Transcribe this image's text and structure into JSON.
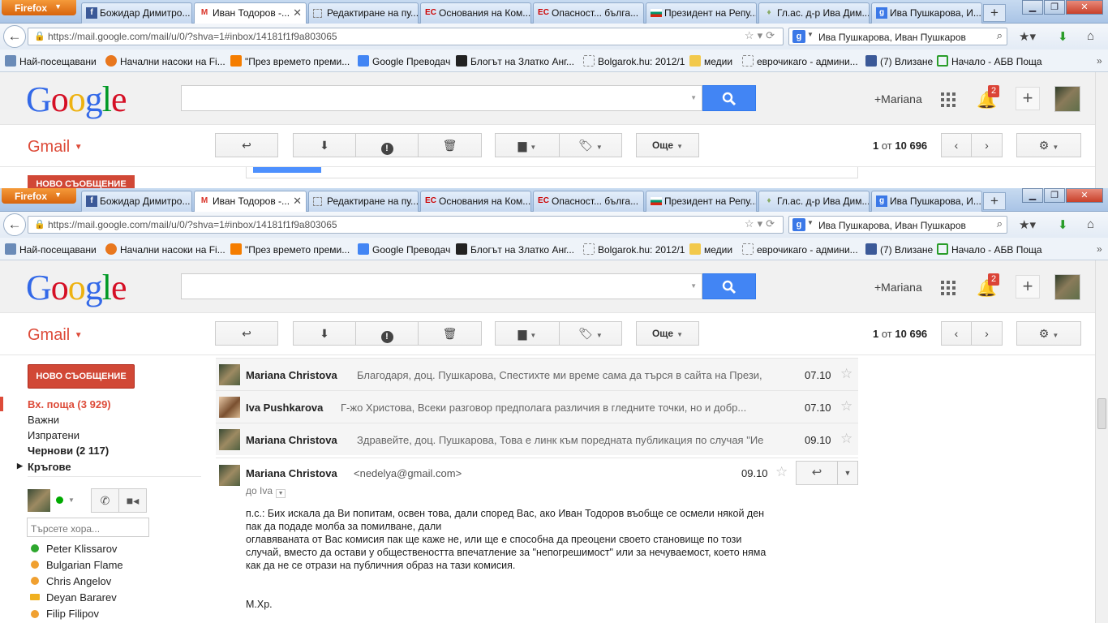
{
  "browser": {
    "button": "Firefox",
    "tabs": [
      {
        "title": "Божидар Димитро...",
        "icon": "facebook-icon"
      },
      {
        "title": "Иван Тодоров -...",
        "icon": "gmail-icon"
      },
      {
        "title": "Редактиране на пу...",
        "icon": "page-icon"
      },
      {
        "title": "Основания на Ком...",
        "icon": "ec-icon"
      },
      {
        "title": "Опасност... бълга...",
        "icon": "ec-icon"
      },
      {
        "title": "Президент на Репу...",
        "icon": "flag-icon"
      },
      {
        "title": "Гл.ас. д-р Ива Дим...",
        "icon": "pin-icon"
      },
      {
        "title": "Ива Пушкарова, И...",
        "icon": "google-icon"
      }
    ],
    "url": "https://mail.google.com/mail/u/0/?shva=1#inbox/14181f1f9a803065",
    "search_value": "Ива Пушкарова, Иван Пушкаров",
    "bookmarks": [
      "Най-посещавани",
      "Начални насоки на Fi...",
      "\"През времето преми...",
      "Google Преводач",
      "Блогът на Златко Анг...",
      "Bolgarok.hu: 2012/1",
      "медии",
      "еврочикаго - админи...",
      "(7) Влизане",
      "Начало - АБВ Поща"
    ]
  },
  "google": {
    "logo": "Google",
    "plus_name": "+Mariana",
    "notifications": "2"
  },
  "gmail": {
    "label": "Gmail",
    "more": "Още",
    "count_prefix": "1",
    "count_of": "от",
    "count_total": "10 696",
    "new_message": "НОВО СЪОБЩЕНИЕ",
    "nav": [
      "Вх. поща (3 929)",
      "Важни",
      "Изпратени",
      "Чернови (2 117)",
      "Кръгове"
    ],
    "chat_search_placeholder": "Търсете хора...",
    "contacts": [
      "Peter Klissarov",
      "Bulgarian Flame",
      "Chris Angelov",
      "Deyan Bararev",
      "Filip Filipov"
    ]
  },
  "thread": {
    "rows": [
      {
        "sender": "Mariana Christova",
        "snippet": "Благодаря, доц. Пушкарова, Спестихте ми време сама да търся в сайта на Прези,",
        "date": "07.10"
      },
      {
        "sender": "Iva Pushkarova",
        "snippet": "Г-жо Христова, Всеки разговор предполага различия в гледните точки, но и добр...",
        "date": "07.10"
      },
      {
        "sender": "Mariana Christova",
        "snippet": "Здравейте, доц. Пушкарова, Това е линк към поредната публикация по случая \"Ие",
        "date": "09.10"
      }
    ],
    "open": {
      "sender": "Mariana Christova",
      "email": "<nedelya@gmail.com>",
      "date": "09.10",
      "to": "до Iva",
      "lines": [
        "п.с.: Бих искала да Ви попитам, освен това, дали според Вас, ако Иван Тодоров въобще се осмели някой ден",
        "пак да подаде молба за помилване, дали",
        "оглавяваната от Вас комисия пак ще каже не, или ще е способна да преоцени своето становище по този",
        "случай, вместо да остави у обществеността впечатление за \"непогрешимост\" или за нечуваемост, което няма",
        "как да не се отрази на публичния образ на тази комисия."
      ],
      "signature": "М.Хр."
    }
  }
}
